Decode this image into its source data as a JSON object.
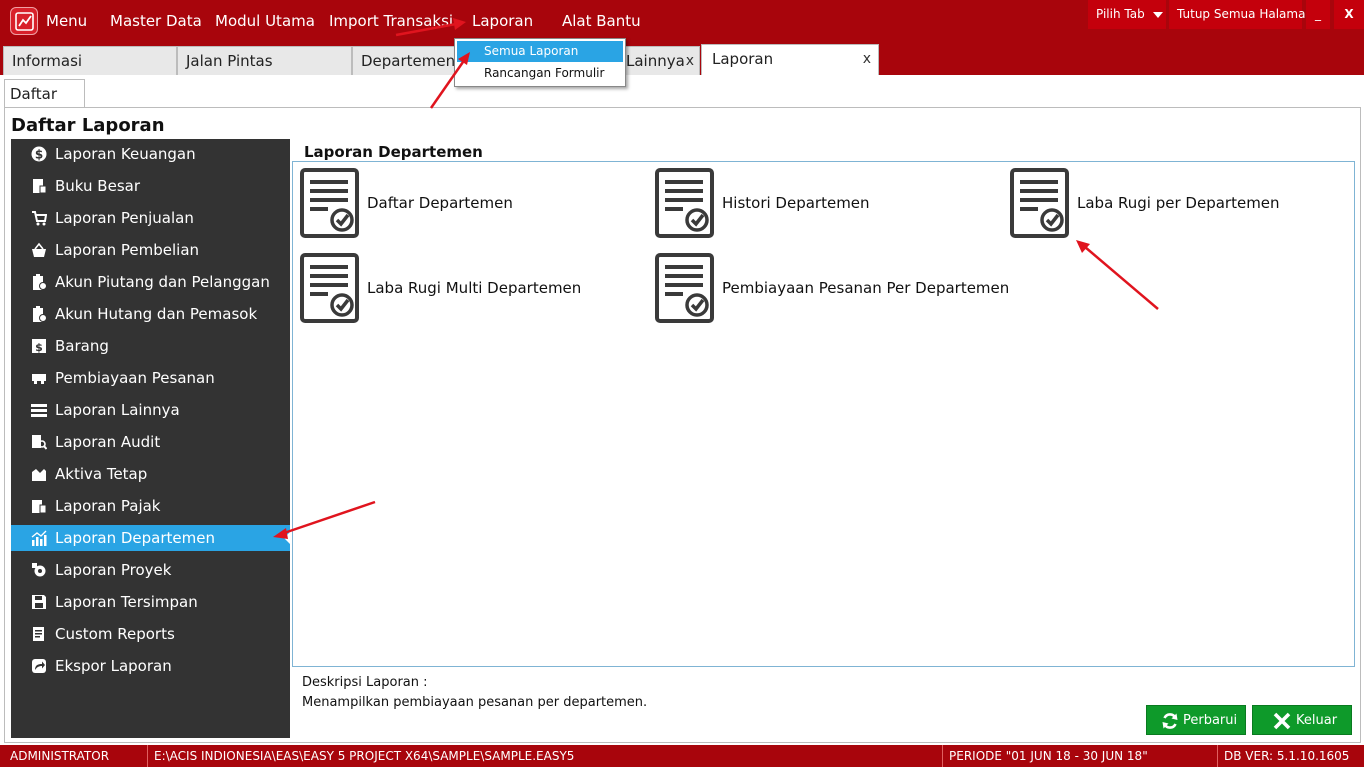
{
  "colors": {
    "brand_red": "#a8050c",
    "button_red": "#c4000c",
    "sidebar_bg": "#333333",
    "selection_blue": "#2aa4e4",
    "button_green": "#0e9a2a",
    "annotation_red": "#e0141e"
  },
  "menubar": {
    "logo_icon": "chart-logo-icon",
    "items": [
      "Menu",
      "Master Data",
      "Modul Utama",
      "Import Transaksi",
      "Laporan",
      "Alat Bantu"
    ],
    "pilih_tab": "Pilih Tab",
    "tutup_semua": "Tutup Semua Halaman",
    "minimize": "_",
    "close": "X"
  },
  "dropdown": {
    "items": [
      "Semua Laporan",
      "Rancangan Formulir"
    ],
    "active_index": 0
  },
  "tabs": {
    "items": [
      "Informasi",
      "Jalan Pintas",
      "Departemen",
      "Lainnya",
      "Laporan"
    ],
    "close_glyph": "x",
    "active": "Laporan"
  },
  "subtab": {
    "label": "Daftar"
  },
  "page": {
    "title": "Daftar Laporan"
  },
  "sidebar": {
    "items": [
      {
        "label": "Laporan Keuangan",
        "icon": "dollar-circle-icon"
      },
      {
        "label": "Buku Besar",
        "icon": "ledger-book-icon"
      },
      {
        "label": "Laporan Penjualan",
        "icon": "shopping-cart-icon"
      },
      {
        "label": "Laporan Pembelian",
        "icon": "basket-icon"
      },
      {
        "label": "Akun Piutang dan Pelanggan",
        "icon": "clipboard-user-icon"
      },
      {
        "label": "Akun Hutang dan Pemasok",
        "icon": "clipboard-supplier-icon"
      },
      {
        "label": "Barang",
        "icon": "box-icon"
      },
      {
        "label": "Pembiayaan Pesanan",
        "icon": "order-cost-icon"
      },
      {
        "label": "Laporan Lainnya",
        "icon": "list-bars-icon"
      },
      {
        "label": "Laporan Audit",
        "icon": "audit-search-icon"
      },
      {
        "label": "Aktiva Tetap",
        "icon": "building-icon"
      },
      {
        "label": "Laporan Pajak",
        "icon": "tax-document-icon"
      },
      {
        "label": "Laporan Departemen",
        "icon": "bar-chart-icon"
      },
      {
        "label": "Laporan Proyek",
        "icon": "project-gear-icon"
      },
      {
        "label": "Laporan Tersimpan",
        "icon": "floppy-disk-icon"
      },
      {
        "label": "Custom Reports",
        "icon": "custom-report-icon"
      },
      {
        "label": "Ekspor Laporan",
        "icon": "export-arrow-icon"
      }
    ],
    "selected_index": 12
  },
  "panel": {
    "title": "Laporan Departemen",
    "reports": [
      {
        "label": "Daftar Departemen",
        "icon": "report-check-icon"
      },
      {
        "label": "Histori Departemen",
        "icon": "report-check-icon"
      },
      {
        "label": "Laba Rugi per Departemen",
        "icon": "report-check-icon"
      },
      {
        "label": "Laba Rugi Multi Departemen",
        "icon": "report-check-icon"
      },
      {
        "label": "Pembiayaan Pesanan Per Departemen",
        "icon": "report-check-icon"
      }
    ]
  },
  "description": {
    "label": "Deskripsi Laporan :",
    "text": "Menampilkan pembiayaan pesanan per departemen."
  },
  "buttons": {
    "refresh": {
      "label": "Perbarui",
      "icon": "refresh-icon"
    },
    "exit": {
      "label": "Keluar",
      "icon": "x-close-icon"
    }
  },
  "status": {
    "user": "ADMINISTRATOR",
    "path": "E:\\ACIS INDIONESIA\\EAS\\EASY 5 PROJECT X64\\SAMPLE\\SAMPLE.EASY5",
    "periode": "PERIODE \"01 JUN 18 - 30 JUN 18\"",
    "db_version": "DB VER: 5.1.10.1605"
  }
}
